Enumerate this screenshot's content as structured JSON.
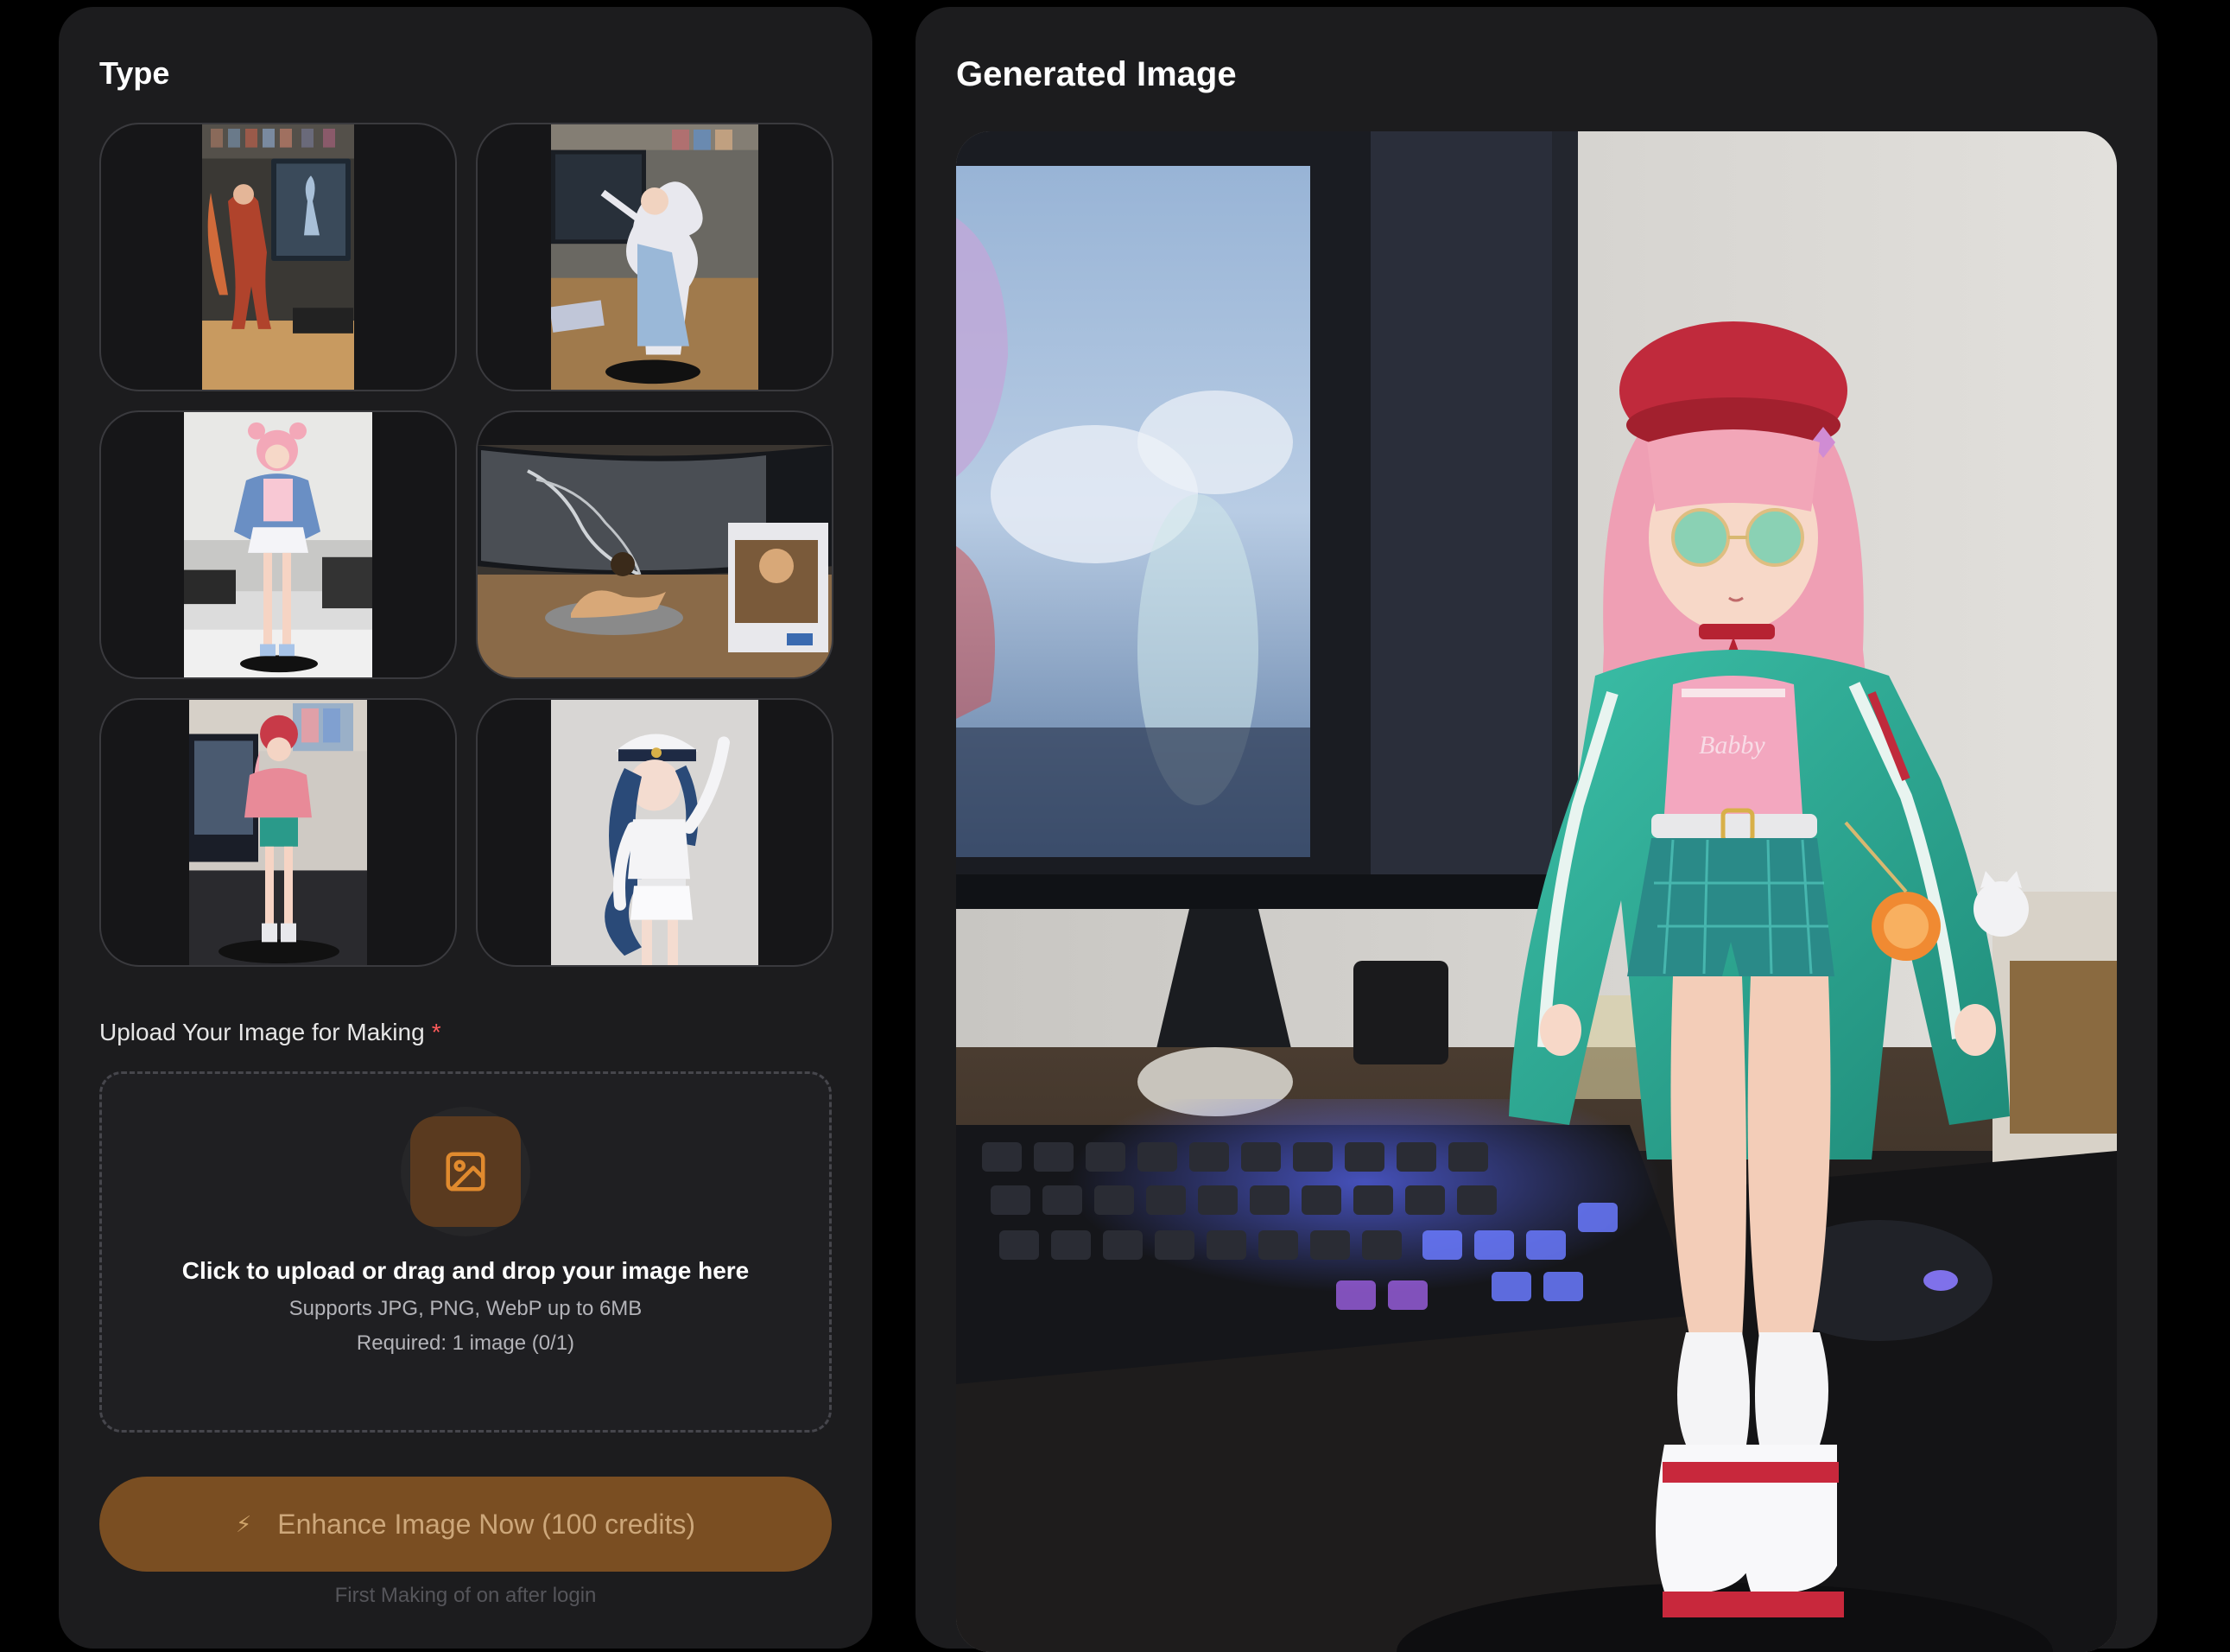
{
  "left_panel": {
    "title": "Type",
    "type_options": [
      {
        "id": "type-1"
      },
      {
        "id": "type-2"
      },
      {
        "id": "type-3"
      },
      {
        "id": "type-4"
      },
      {
        "id": "type-5"
      },
      {
        "id": "type-6"
      }
    ],
    "upload": {
      "label": "Upload Your Image for Making",
      "required_marker": "*",
      "dropzone_title": "Click to upload or drag and drop your image here",
      "dropzone_formats": "Supports JPG, PNG, WebP up to 6MB",
      "dropzone_requirement": "Required: 1 image (0/1)",
      "icon": "image-icon"
    },
    "enhance_button": {
      "icon": "lightning-icon",
      "label": "Enhance Image Now (100 credits)"
    },
    "footnote": "First Making of on after login"
  },
  "right_panel": {
    "title": "Generated Image"
  },
  "colors": {
    "page_bg": "#000000",
    "panel_bg": "#1c1c1e",
    "accent": "#7a4e22",
    "accent_icon": "#e08a2e",
    "required": "#ff5b5b"
  }
}
